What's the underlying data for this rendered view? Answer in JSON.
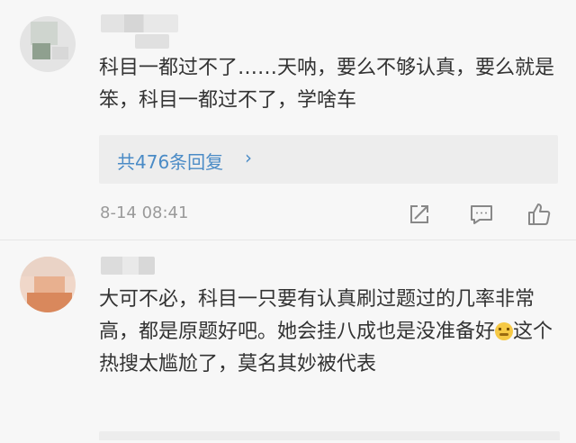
{
  "comments": [
    {
      "text": "科目一都过不了……天呐，要么不够认真，要么就是笨，科目一都过不了，学啥车",
      "replies_label": "共476条回复",
      "replies_chevron": "›",
      "timestamp": "8-14 08:41",
      "actions": [
        "share-icon",
        "comment-icon",
        "like-icon"
      ]
    },
    {
      "text_before_emoji": "大可不必，科目一只要有认真刷过题过的几率非常高，都是原题好吧。她会挂八成也是没准备好",
      "emoji": "sweat-emoji",
      "text_after_emoji": "这个热搜太尴尬了，莫名其妙被代表"
    }
  ],
  "colors": {
    "background": "#f7f7f7",
    "text": "#333333",
    "link": "#4a8bc6",
    "meta": "#9a9a9a",
    "reply_box": "#ededed"
  }
}
